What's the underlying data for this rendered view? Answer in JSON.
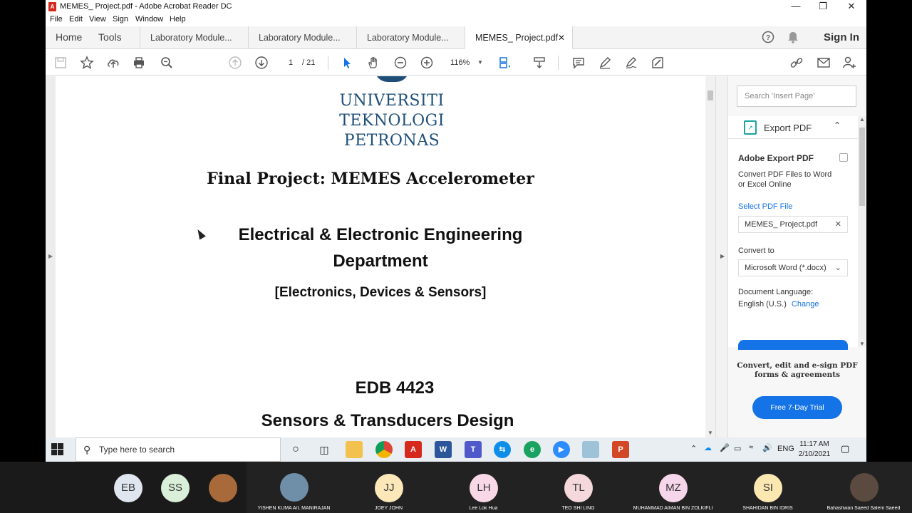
{
  "window": {
    "title": "MEMES_ Project.pdf - Adobe Acrobat Reader DC",
    "minimize": "—",
    "restore": "❐",
    "close": "✕"
  },
  "menu": [
    "File",
    "Edit",
    "View",
    "Sign",
    "Window",
    "Help"
  ],
  "nav": {
    "home": "Home",
    "tools": "Tools",
    "sign_in": "Sign In"
  },
  "tabs": [
    {
      "label": "Laboratory Module...",
      "active": false
    },
    {
      "label": "Laboratory Module...",
      "active": false
    },
    {
      "label": "Laboratory Module...",
      "active": false
    },
    {
      "label": "MEMES_ Project.pdf",
      "active": true,
      "close": "✕"
    }
  ],
  "toolbar": {
    "page_current": "1",
    "page_total": "/ 21",
    "zoom": "116%"
  },
  "document": {
    "logo_lines": [
      "UNIVERSITI",
      "TEKNOLOGI",
      "PETRONAS"
    ],
    "title": "Final Project: MEMES Accelerometer",
    "dept_line1": "Electrical & Electronic Engineering",
    "dept_line2": "Department",
    "subdept": "[Electronics, Devices & Sensors]",
    "course_code": "EDB 4423",
    "course_name": "Sensors & Transducers Design"
  },
  "right_panel": {
    "search_placeholder": "Search 'Insert Page'",
    "export_title": "Export PDF",
    "adobe_export": "Adobe Export PDF",
    "convert_desc_1": "Convert PDF Files to Word",
    "convert_desc_2": "or Excel Online",
    "select_pdf": "Select PDF File",
    "selected_file": "MEMES_ Project.pdf",
    "convert_to": "Convert to",
    "convert_format": "Microsoft Word (*.docx)",
    "doc_language": "Document Language:",
    "language": "English (U.S.)",
    "change": "Change",
    "promo_1": "Convert, edit and e-sign PDF",
    "promo_2": "forms & agreements",
    "trial_button": "Free 7-Day Trial"
  },
  "taskbar": {
    "search_placeholder": "Type here to search",
    "lang": "ENG",
    "time": "11:17 AM",
    "date": "2/10/2021"
  },
  "participants": [
    {
      "initials": "EB",
      "name": "",
      "color": "#dfe6f0"
    },
    {
      "initials": "SS",
      "name": "",
      "color": "#d9efd9"
    },
    {
      "initials": "",
      "name": "",
      "color": "#a86a3a"
    },
    {
      "initials": "",
      "name": "YISHEN KUMA A/L MANIRAJAN",
      "color": "#6f8fa8"
    },
    {
      "initials": "JJ",
      "name": "JOEY JOHN",
      "color": "#fbe7b8"
    },
    {
      "initials": "LH",
      "name": "Lee Lok Hua",
      "color": "#f8d8e6"
    },
    {
      "initials": "TL",
      "name": "TEO SHI LING",
      "color": "#f4d8dc"
    },
    {
      "initials": "MZ",
      "name": "MUHAMMAD AIMAN BIN ZOLKIFLI",
      "color": "#f6d6ea"
    },
    {
      "initials": "SI",
      "name": "SHAHIDAN BIN IDRIS",
      "color": "#fbe7b0"
    },
    {
      "initials": "",
      "name": "Bahashwan Saeed Salem Saeed",
      "color": "#5b4a3f"
    }
  ]
}
